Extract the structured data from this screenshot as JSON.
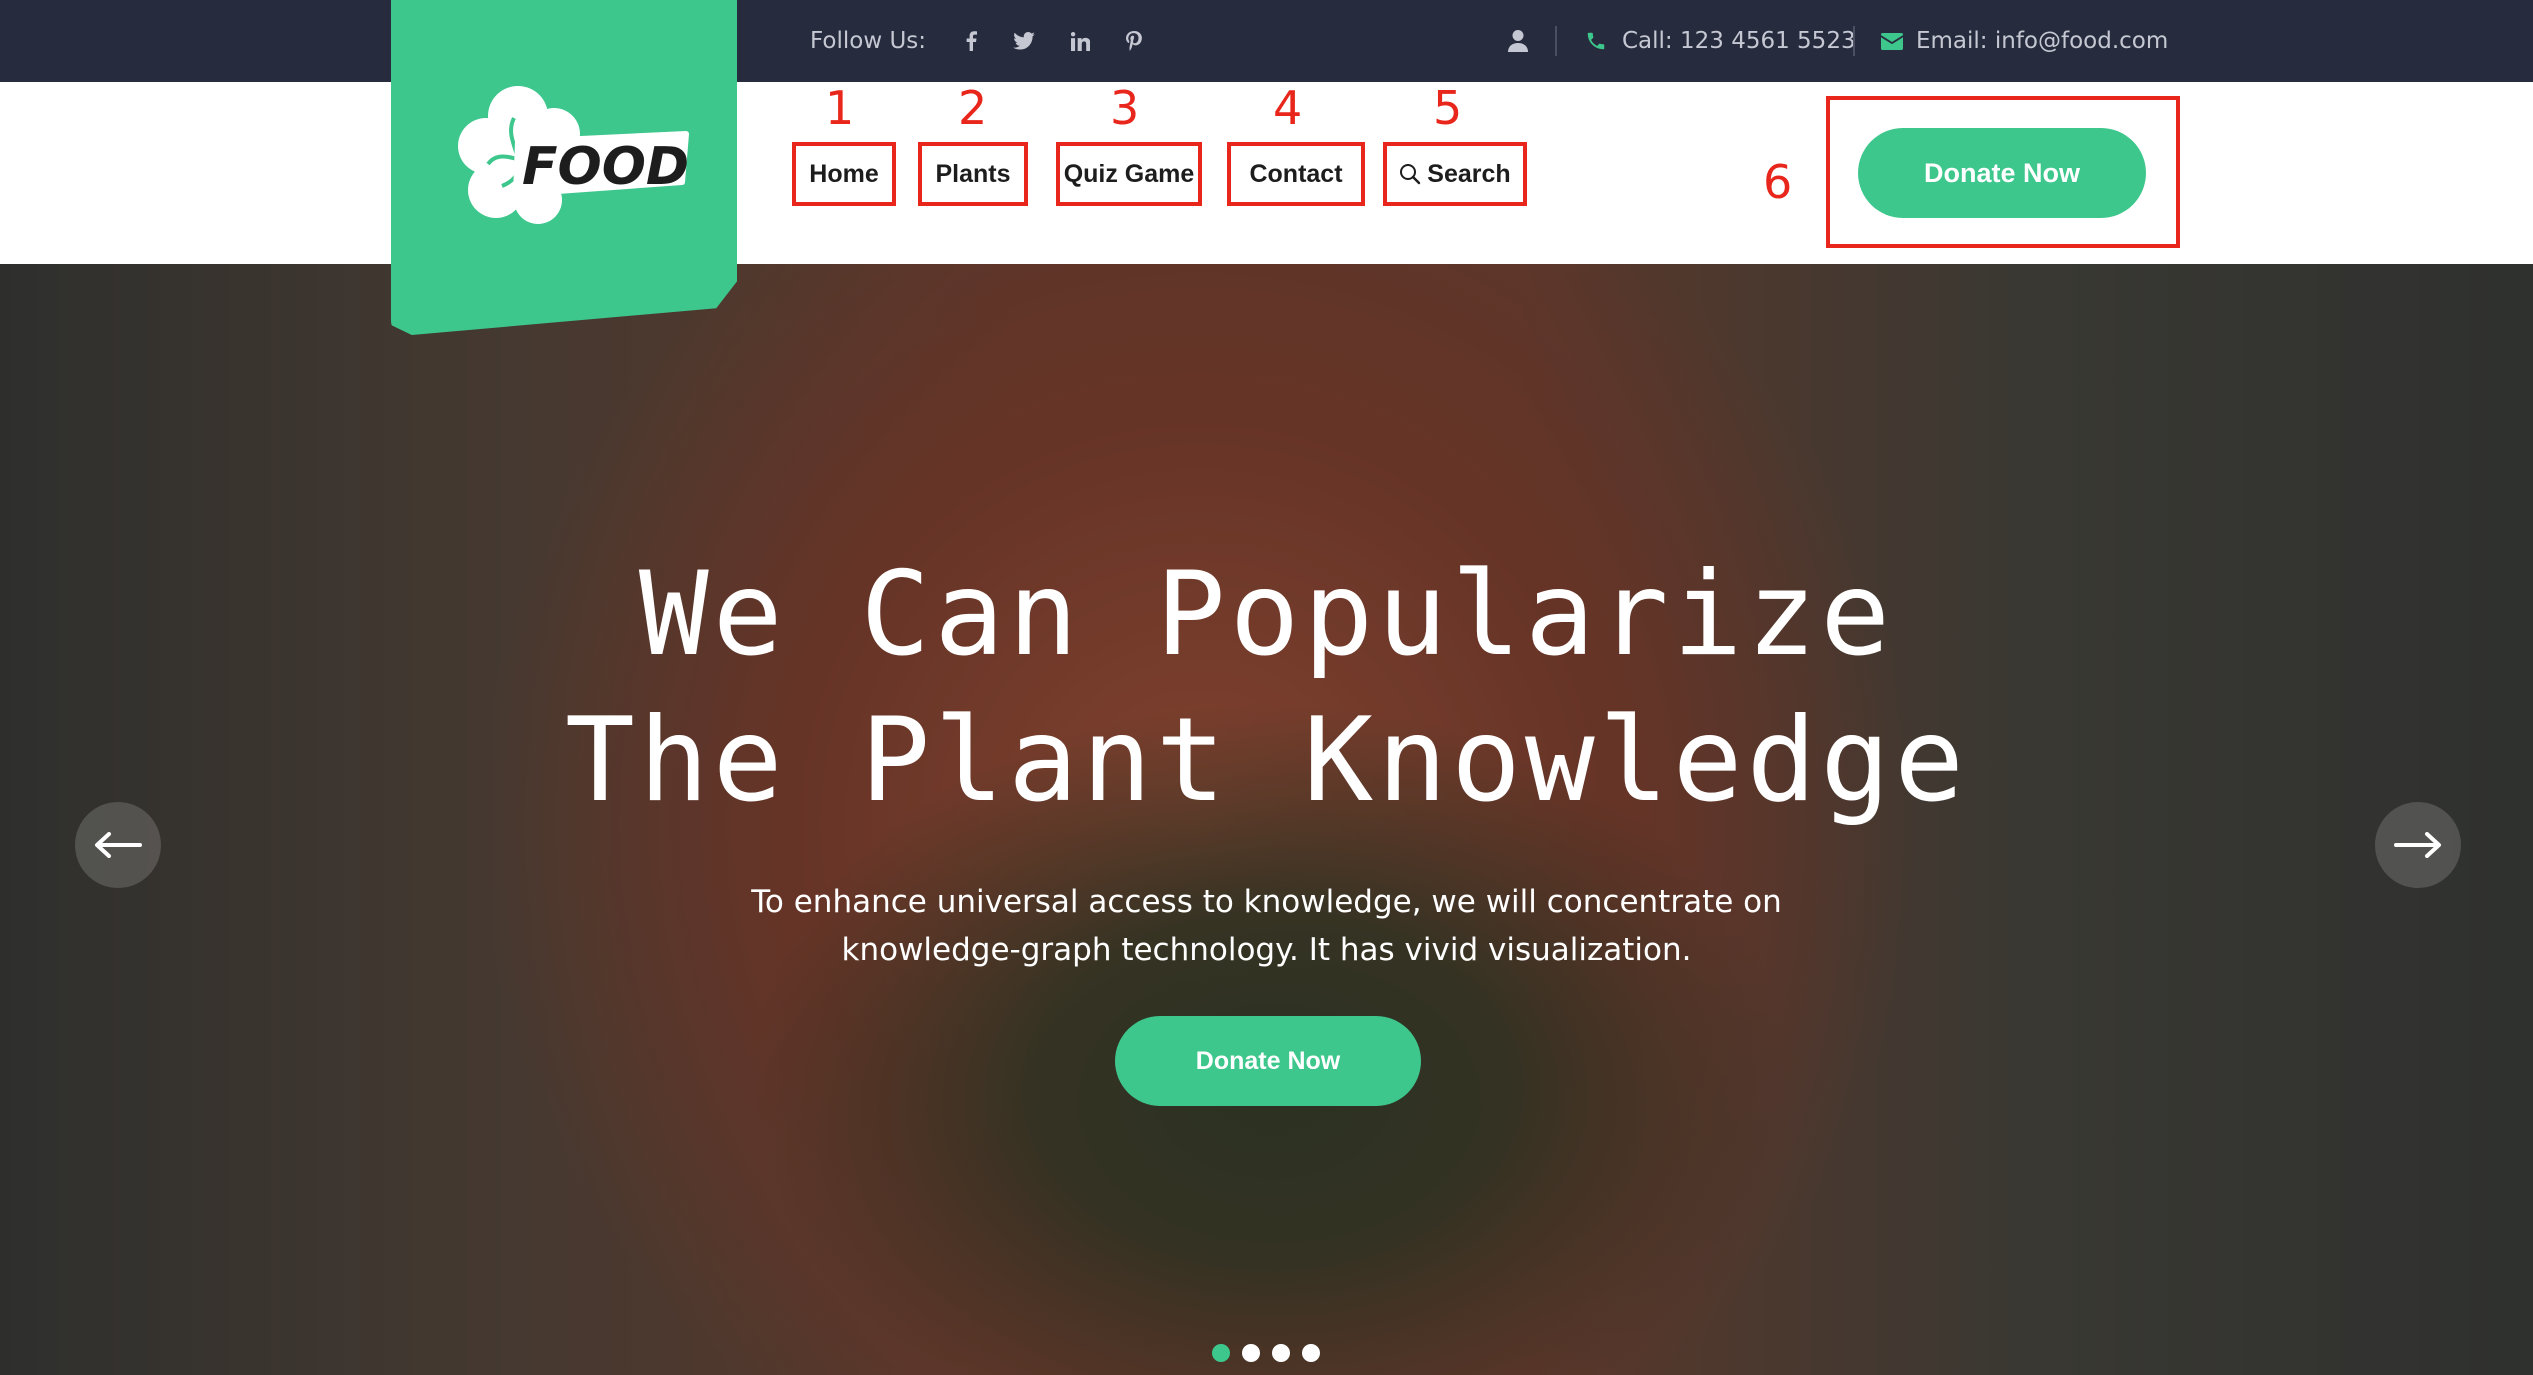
{
  "topbar": {
    "follow_label": "Follow Us:",
    "socials": [
      "facebook-icon",
      "twitter-icon",
      "linkedin-icon",
      "pinterest-icon"
    ],
    "user_icon": "user-icon",
    "call_text": "Call:  123 4561 5523",
    "email_text": "Email:  info@food.com"
  },
  "logo": {
    "text": "FOOD",
    "color": "#3dc78c"
  },
  "nav": {
    "items": [
      {
        "number": "1",
        "label": "Home"
      },
      {
        "number": "2",
        "label": "Plants"
      },
      {
        "number": "3",
        "label": "Quiz Game"
      },
      {
        "number": "4",
        "label": "Contact"
      },
      {
        "number": "5",
        "label": "Search"
      }
    ],
    "donate_number": "6",
    "donate_label": "Donate Now"
  },
  "hero": {
    "title_line1": "We Can Popularize",
    "title_line2": "The Plant Knowledge",
    "subtitle_line1": "To enhance universal access to knowledge, we will concentrate on",
    "subtitle_line2": "knowledge-graph technology. It has vivid visualization.",
    "button_label": "Donate Now",
    "slides_total": 4,
    "active_slide": 1
  },
  "colors": {
    "accent": "#3dc78c",
    "topbar_bg": "#262b3d",
    "annotation_red": "#e8261b"
  }
}
